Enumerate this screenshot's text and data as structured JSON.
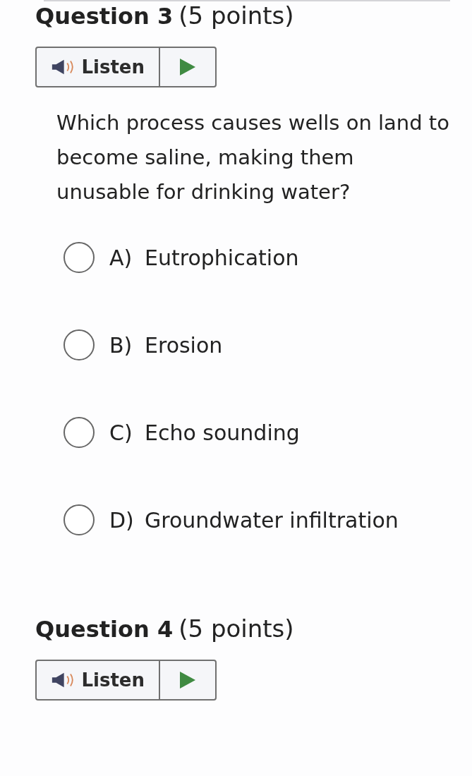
{
  "questions": [
    {
      "title": "Question 3",
      "points": "(5 points)",
      "listen": "Listen",
      "prompt": "Which process causes wells on land to become saline, making them unusable for drinking water?",
      "options": [
        {
          "letter": "A)",
          "text": "Eutrophication",
          "selected": false
        },
        {
          "letter": "B)",
          "text": "Erosion",
          "selected": false
        },
        {
          "letter": "C)",
          "text": "Echo sounding",
          "selected": false
        },
        {
          "letter": "D)",
          "text": "Groundwater infiltration",
          "selected": false
        }
      ]
    },
    {
      "title": "Question 4",
      "points": "(5 points)",
      "listen": "Listen"
    }
  ]
}
